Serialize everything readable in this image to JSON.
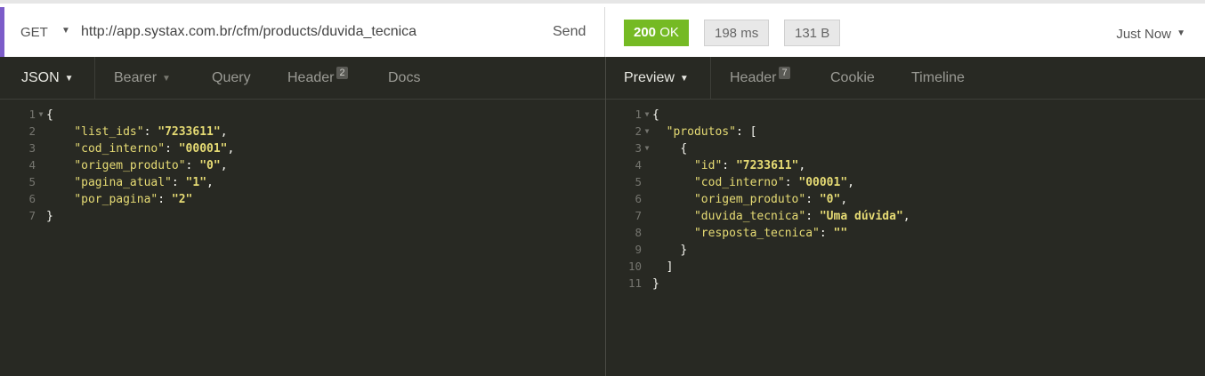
{
  "request": {
    "method": "GET",
    "url": "http://app.systax.com.br/cfm/products/duvida_tecnica",
    "send_label": "Send",
    "tabs": [
      {
        "label": "JSON",
        "caret": true
      },
      {
        "label": "Bearer",
        "caret": true
      },
      {
        "label": "Query"
      },
      {
        "label": "Header",
        "count": "2"
      },
      {
        "label": "Docs"
      }
    ],
    "body_lines": [
      {
        "n": "1",
        "fold": true,
        "t": "{"
      },
      {
        "n": "2",
        "key": "\"list_ids\"",
        "val": "\"7233611\"",
        "end": ","
      },
      {
        "n": "3",
        "key": "\"cod_interno\"",
        "val": "\"00001\"",
        "end": ","
      },
      {
        "n": "4",
        "key": "\"origem_produto\"",
        "val": "\"0\"",
        "end": ","
      },
      {
        "n": "5",
        "key": "\"pagina_atual\"",
        "val": "\"1\"",
        "end": ","
      },
      {
        "n": "6",
        "key": "\"por_pagina\"",
        "val": "\"2\"",
        "end": ""
      },
      {
        "n": "7",
        "t": "}"
      }
    ]
  },
  "response": {
    "status": "200 OK",
    "status_code": "200",
    "status_text": "OK",
    "time": "198 ms",
    "size": "131 B",
    "history_label": "Just Now",
    "tabs": [
      {
        "label": "Preview",
        "caret": true
      },
      {
        "label": "Header",
        "count": "7"
      },
      {
        "label": "Cookie"
      },
      {
        "label": "Timeline"
      }
    ],
    "preview_lines": [
      {
        "n": "1",
        "fold": true,
        "t": "{"
      },
      {
        "n": "2",
        "fold": true,
        "indent": "  ",
        "key": "\"produtos\"",
        "rest": ": ["
      },
      {
        "n": "3",
        "fold": true,
        "indent": "    ",
        "t": "{"
      },
      {
        "n": "4",
        "indent": "      ",
        "key": "\"id\"",
        "val": "\"7233611\"",
        "end": ","
      },
      {
        "n": "5",
        "indent": "      ",
        "key": "\"cod_interno\"",
        "val": "\"00001\"",
        "end": ","
      },
      {
        "n": "6",
        "indent": "      ",
        "key": "\"origem_produto\"",
        "val": "\"0\"",
        "end": ","
      },
      {
        "n": "7",
        "indent": "      ",
        "key": "\"duvida_tecnica\"",
        "val": "\"Uma dúvida\"",
        "end": ","
      },
      {
        "n": "8",
        "indent": "      ",
        "key": "\"resposta_tecnica\"",
        "val": "\"\"",
        "end": ""
      },
      {
        "n": "9",
        "indent": "    ",
        "t": "}"
      },
      {
        "n": "10",
        "indent": "  ",
        "t": "]"
      },
      {
        "n": "11",
        "t": "}"
      }
    ]
  },
  "colors": {
    "accent": "#7c5cc9",
    "ok": "#75ba24",
    "editor_bg": "#282923",
    "string": "#e6db74"
  }
}
